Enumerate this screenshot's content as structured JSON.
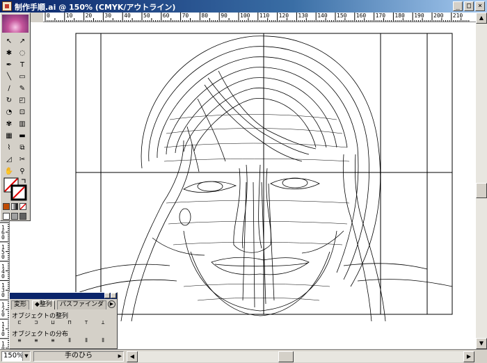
{
  "window": {
    "title": "制作手順.ai @ 150% (CMYK/アウトライン)"
  },
  "window_controls": {
    "minimize": "_",
    "maximize": "□",
    "close": "×"
  },
  "rulers": {
    "top_labels": [
      "0",
      "10",
      "20",
      "30",
      "40",
      "50",
      "60",
      "70",
      "80",
      "90",
      "100",
      "110",
      "120",
      "130",
      "140",
      "150",
      "160",
      "170",
      "180",
      "190",
      "200",
      "210"
    ],
    "left_labels": [
      "160",
      "150",
      "140",
      "130",
      "120",
      "110",
      "100"
    ]
  },
  "tools": {
    "items": [
      "arrow-icon",
      "direct-select-icon",
      "magic-wand-icon",
      "lasso-icon",
      "pen-icon",
      "type-icon",
      "line-icon",
      "rectangle-icon",
      "paintbrush-icon",
      "pencil-icon",
      "rotate-icon",
      "scale-icon",
      "warp-icon",
      "free-transform-icon",
      "symbol-sprayer-icon",
      "graph-icon",
      "mesh-icon",
      "gradient-icon",
      "eyedropper-icon",
      "blend-icon",
      "slice-icon",
      "scissors-icon",
      "hand-icon",
      "zoom-icon"
    ],
    "glyphs": [
      "↖",
      "↗",
      "✱",
      "◌",
      "✒",
      "T",
      "╲",
      "▭",
      "∕",
      "✎",
      "↻",
      "◰",
      "◔",
      "⊡",
      "✾",
      "▥",
      "▦",
      "▬",
      "⌇",
      "⧉",
      "◿",
      "✂",
      "✋",
      "⚲"
    ]
  },
  "palette": {
    "tabs": [
      "変形",
      "◆整列",
      "パスファインダ"
    ],
    "section1": "オブジェクトの整列",
    "section2": "オブジェクトの分布",
    "align_icons": [
      "⊏",
      "⊐",
      "⊔",
      "⊓",
      "⊤",
      "⊥"
    ],
    "distribute_icons": [
      "≡",
      "≡",
      "≡",
      "⫴",
      "⫴",
      "⫴"
    ]
  },
  "status": {
    "zoom": "150%",
    "tool": "手のひら"
  }
}
